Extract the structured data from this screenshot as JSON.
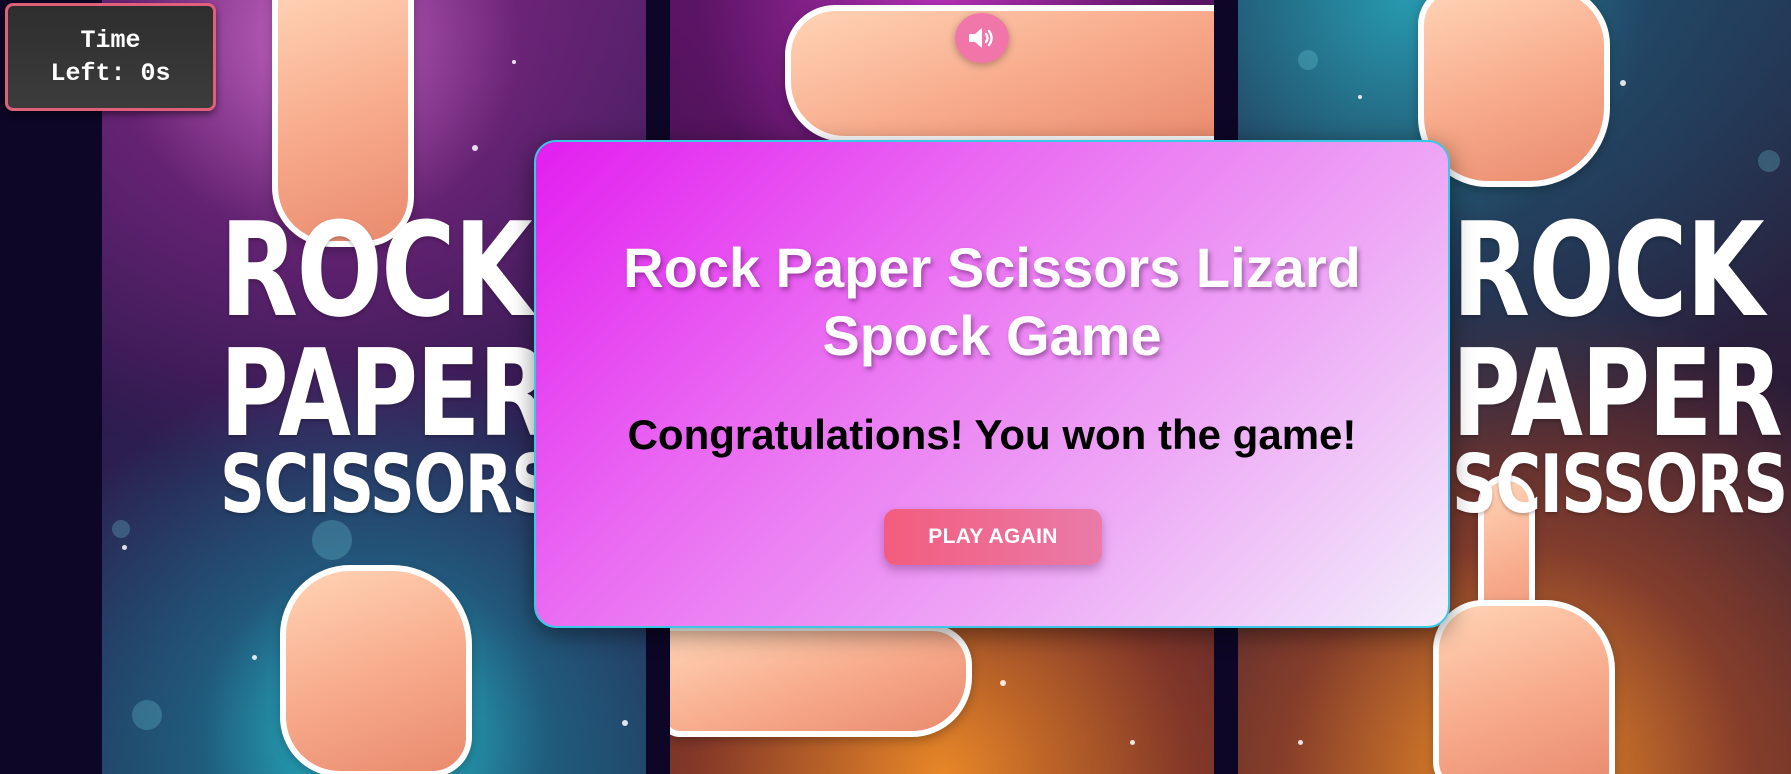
{
  "timer": {
    "line1": "Time",
    "line2": "Left: 0s"
  },
  "sound_toggle": {
    "icon": "speaker-volume-icon"
  },
  "background": {
    "poster_lines": [
      "ROCK",
      "PAPER",
      "SCISSORS"
    ]
  },
  "modal": {
    "title": "Rock Paper Scissors Lizard Spock Game",
    "message": "Congratulations! You won the game!",
    "play_again_label": "PLAY AGAIN"
  },
  "colors": {
    "modal_gradient_start": "#e21ef0",
    "modal_gradient_end": "#f2eefb",
    "modal_border": "#3bc7e6",
    "button_start": "#f25d7e",
    "button_end": "#ea7aa8",
    "timer_border": "#e0607a",
    "timer_bg": "#2e2e2e"
  }
}
